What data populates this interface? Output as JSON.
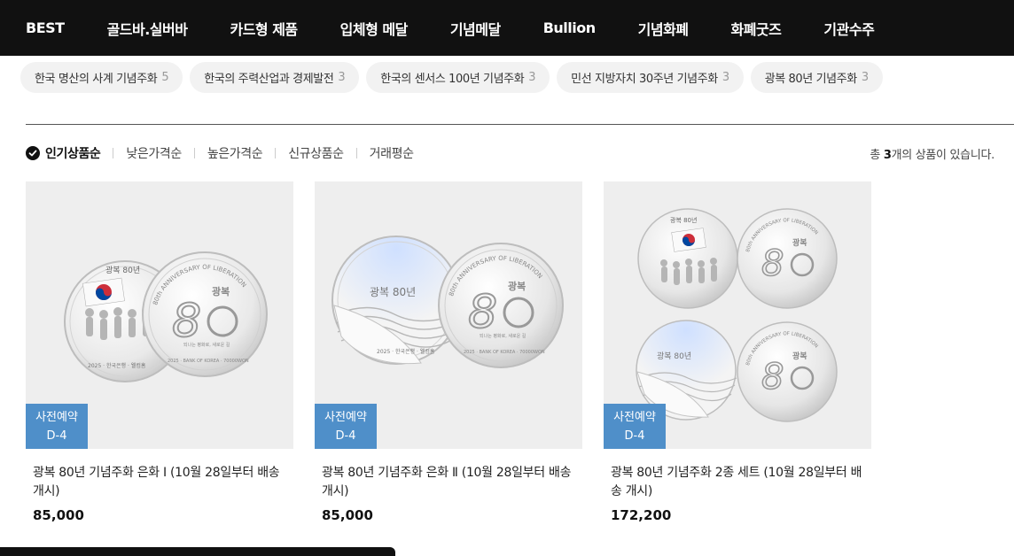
{
  "nav": {
    "items": [
      "BEST",
      "골드바.실버바",
      "카드형 제품",
      "입체형 메달",
      "기념메달",
      "Bullion",
      "기념화폐",
      "화폐굿즈",
      "기관수주"
    ]
  },
  "categories": [
    {
      "label": "한국 명산의 사계 기념주화",
      "count": "5"
    },
    {
      "label": "한국의 주력산업과 경제발전",
      "count": "3"
    },
    {
      "label": "한국의 센서스 100년 기념주화",
      "count": "3"
    },
    {
      "label": "민선 지방자치 30주년 기념주화",
      "count": "3"
    },
    {
      "label": "광복 80년 기념주화",
      "count": "3"
    }
  ],
  "sort": {
    "options": [
      "인기상품순",
      "낮은가격순",
      "높은가격순",
      "신규상품순",
      "거래평순"
    ],
    "active": "인기상품순"
  },
  "total": {
    "prefix": "총 ",
    "count": "3",
    "suffix": "개의 상품이 있습니다."
  },
  "coin_text": {
    "title": "광복 80년",
    "anniversary": "80th ANNIVERSARY OF LIBERATION",
    "gwangbok": "광복",
    "year": "2025 · 한국은행 · 웰컴홈",
    "bank": "2025 · BANK OF KOREA · 70000WON",
    "motto": "되나는 평화로, 새로운 길"
  },
  "products": [
    {
      "badge": "사전예약",
      "dday": "D-4",
      "name": "광복 80년 기념주화 은화 Ⅰ (10월 28일부터 배송 개시)",
      "price": "85,000",
      "image": "coin-set-1"
    },
    {
      "badge": "사전예약",
      "dday": "D-4",
      "name": "광복 80년 기념주화 은화 Ⅱ (10월 28일부터 배송 개시)",
      "price": "85,000",
      "image": "coin-set-2"
    },
    {
      "badge": "사전예약",
      "dday": "D-4",
      "name": "광복 80년 기념주화 2종 세트 (10월 28일부터 배송 개시)",
      "price": "172,200",
      "image": "coin-set-both"
    }
  ]
}
